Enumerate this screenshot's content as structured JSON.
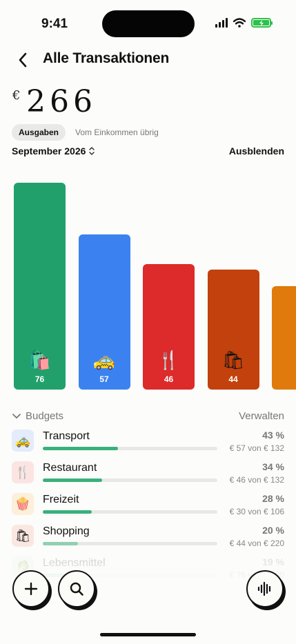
{
  "status_bar": {
    "time": "9:41"
  },
  "header": {
    "title": "Alle Transaktionen"
  },
  "summary": {
    "currency": "€",
    "amount": "266",
    "tab_active": "Ausgaben",
    "tab_inactive": "Vom Einkommen übrig",
    "month": "September 2026",
    "hide_label": "Ausblenden"
  },
  "chart_data": {
    "type": "bar",
    "categories": [
      "Lebensmittel",
      "Transport",
      "Restaurant",
      "Shopping",
      "Freizeit"
    ],
    "values": [
      76,
      57,
      46,
      44,
      38
    ],
    "value_labels": [
      "76",
      "57",
      "46",
      "44",
      ""
    ],
    "emojis": [
      "🛍️",
      "🚕",
      "🍴",
      "🛍",
      ""
    ],
    "colors": [
      "#22a06b",
      "#3b82f0",
      "#dd2a2a",
      "#c2410c",
      "#e07a0c"
    ],
    "ylim": [
      0,
      76
    ]
  },
  "budgets": {
    "title": "Budgets",
    "manage_label": "Verwalten",
    "items": [
      {
        "name": "Transport",
        "percent": "43 %",
        "detail": "€ 57 von € 132",
        "fraction": 0.43,
        "icon": "🚕",
        "icon_bg": "#e3ecfb",
        "bar_color": "#3ab07a"
      },
      {
        "name": "Restaurant",
        "percent": "34 %",
        "detail": "€ 46 von € 132",
        "fraction": 0.34,
        "icon": "🍴",
        "icon_bg": "#fbe4e2",
        "bar_color": "#3ab07a"
      },
      {
        "name": "Freizeit",
        "percent": "28 %",
        "detail": "€ 30 von € 106",
        "fraction": 0.28,
        "icon": "🍿",
        "icon_bg": "#fcefdc",
        "bar_color": "#3ab07a"
      },
      {
        "name": "Shopping",
        "percent": "20 %",
        "detail": "€ 44 von € 220",
        "fraction": 0.2,
        "icon": "🛍",
        "icon_bg": "#fbe7e1",
        "bar_color": "#8fd0b0"
      },
      {
        "name": "Lebensmittel",
        "percent": "19 %",
        "detail": "€ 76 von € 400",
        "fraction": 0.19,
        "icon": "🥬",
        "icon_bg": "#e2f3e4",
        "bar_color": "#8fd0b0"
      }
    ]
  },
  "actions": {
    "add_icon": "plus-icon",
    "search_icon": "search-icon",
    "voice_icon": "waveform-icon"
  }
}
